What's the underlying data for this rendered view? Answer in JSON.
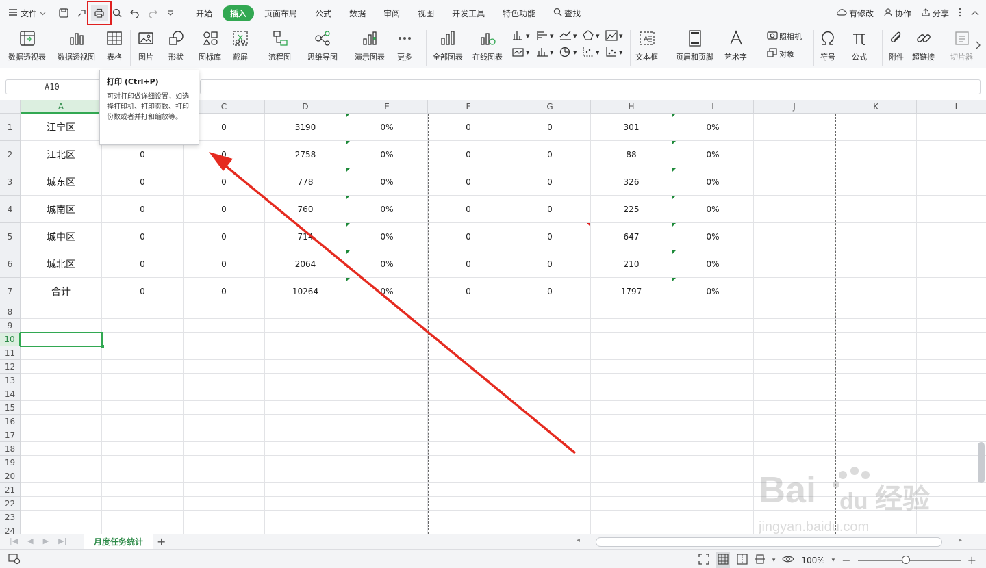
{
  "menubar": {
    "file_label": "文件",
    "tabs": [
      {
        "label": "开始"
      },
      {
        "label": "插入",
        "active": true
      },
      {
        "label": "页面布局"
      },
      {
        "label": "公式"
      },
      {
        "label": "数据"
      },
      {
        "label": "审阅"
      },
      {
        "label": "视图"
      },
      {
        "label": "开发工具"
      },
      {
        "label": "特色功能"
      },
      {
        "label": "查找"
      }
    ],
    "right": {
      "modified": "有修改",
      "collab": "协作",
      "share": "分享"
    }
  },
  "ribbon": {
    "items": [
      "数据透视表",
      "数据透视图",
      "表格",
      "图片",
      "形状",
      "图标库",
      "截屏",
      "流程图",
      "思维导图",
      "演示图表",
      "更多",
      "全部图表",
      "在线图表",
      "照相机",
      "对象",
      "文本框",
      "页眉和页脚",
      "艺术字",
      "符号",
      "公式",
      "附件",
      "超链接",
      "切片器"
    ]
  },
  "formula_bar": {
    "name_box": "A10"
  },
  "tooltip": {
    "title": "打印 (Ctrl+P)",
    "body": "可对打印做详细设置，如选择打印机、打印页数、打印份数或者并打和缩放等。"
  },
  "grid": {
    "columns": [
      "A",
      "B",
      "C",
      "D",
      "E",
      "F",
      "G",
      "H",
      "I",
      "J",
      "K",
      "L"
    ],
    "selected_column": "A",
    "selected_row": 10,
    "rows": [
      1,
      2,
      3,
      4,
      5,
      6,
      7,
      8,
      9,
      10,
      11,
      12,
      13,
      14,
      15,
      16,
      17,
      18,
      19,
      20,
      21,
      22,
      23,
      24
    ],
    "data": [
      [
        "江宁区",
        "",
        "0",
        "3190",
        "0%",
        "0",
        "0",
        "301",
        "0%"
      ],
      [
        "江北区",
        "0",
        "0",
        "2758",
        "0%",
        "0",
        "0",
        "88",
        "0%"
      ],
      [
        "城东区",
        "0",
        "0",
        "778",
        "0%",
        "0",
        "0",
        "326",
        "0%"
      ],
      [
        "城南区",
        "0",
        "0",
        "760",
        "0%",
        "0",
        "0",
        "225",
        "0%"
      ],
      [
        "城中区",
        "0",
        "0",
        "714",
        "0%",
        "0",
        "0",
        "647",
        "0%"
      ],
      [
        "城北区",
        "0",
        "0",
        "2064",
        "0%",
        "0",
        "0",
        "210",
        "0%"
      ],
      [
        "合计",
        "0",
        "0",
        "10264",
        "0%",
        "0",
        "0",
        "1797",
        "0%"
      ]
    ]
  },
  "sheets": {
    "active": "月度任务统计"
  },
  "statusbar": {
    "zoom": "100%"
  },
  "watermark": {
    "line1": "Bai",
    "line2": "du",
    "line3": "经验",
    "url": "jingyan.baidu.com"
  },
  "colors": {
    "accent": "#32a852",
    "highlight": "#e02020"
  }
}
